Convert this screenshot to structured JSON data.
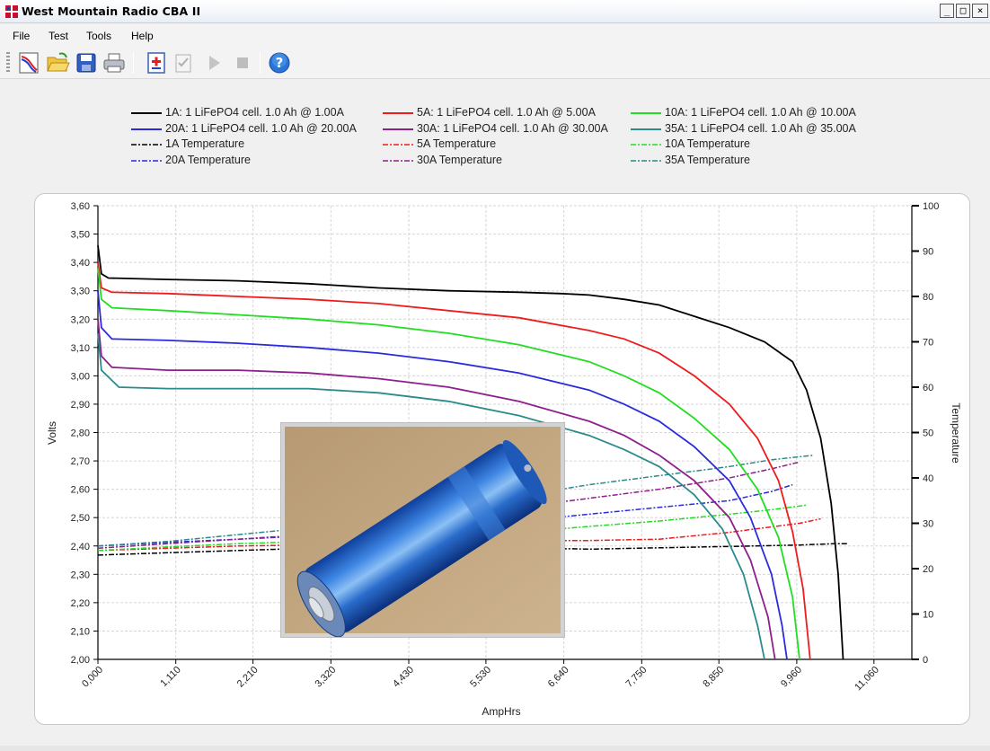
{
  "window": {
    "title": "West Mountain Radio CBA II",
    "controls": {
      "minimize": "_",
      "maximize": "□",
      "close": "×"
    }
  },
  "menu": [
    "File",
    "Test",
    "Tools",
    "Help"
  ],
  "toolbar": [
    "new-test-icon",
    "open-folder-icon",
    "save-icon",
    "print-icon",
    "add-test-icon",
    "checklist-icon",
    "play-icon",
    "stop-icon",
    "help-icon"
  ],
  "legend": [
    {
      "label": "1A: 1 LiFePO4 cell. 1.0 Ah @ 1.00A",
      "color": "#000000",
      "style": "solid"
    },
    {
      "label": "5A: 1 LiFePO4 cell. 1.0 Ah @ 5.00A",
      "color": "#ee1c1c",
      "style": "solid"
    },
    {
      "label": "10A: 1 LiFePO4 cell. 1.0 Ah @ 10.00A",
      "color": "#22dd22",
      "style": "solid"
    },
    {
      "label": "20A: 1 LiFePO4 cell. 1.0 Ah @ 20.00A",
      "color": "#2b2bdd",
      "style": "solid"
    },
    {
      "label": "30A: 1 LiFePO4 cell. 1.0 Ah @ 30.00A",
      "color": "#8e1f8e",
      "style": "solid"
    },
    {
      "label": "35A: 1 LiFePO4 cell. 1.0 Ah @ 35.00A",
      "color": "#2b8a8a",
      "style": "solid"
    },
    {
      "label": "1A Temperature",
      "color": "#000000",
      "style": "dashdot"
    },
    {
      "label": "5A Temperature",
      "color": "#ee1c1c",
      "style": "dashdot"
    },
    {
      "label": "10A Temperature",
      "color": "#22dd22",
      "style": "dashdot"
    },
    {
      "label": "20A Temperature",
      "color": "#2b2bdd",
      "style": "dashdot"
    },
    {
      "label": "30A Temperature",
      "color": "#8e1f8e",
      "style": "dashdot"
    },
    {
      "label": "35A Temperature",
      "color": "#2b8a8a",
      "style": "dashdot"
    }
  ],
  "chart_data": {
    "type": "line",
    "xlabel": "AmpHrs",
    "ylabel": "Volts",
    "y2label": "Temperature",
    "xlim": [
      0,
      11.6
    ],
    "ylim": [
      2.0,
      3.6
    ],
    "y2lim": [
      0,
      100
    ],
    "xticks": [
      "0,000",
      "1,110",
      "2,210",
      "3,320",
      "4,430",
      "5,530",
      "6,640",
      "7,750",
      "8,850",
      "9,960",
      "11,060"
    ],
    "xtick_values": [
      0,
      1.11,
      2.21,
      3.32,
      4.43,
      5.53,
      6.64,
      7.75,
      8.85,
      9.96,
      11.06
    ],
    "yticks": [
      "2,00",
      "2,10",
      "2,20",
      "2,30",
      "2,40",
      "2,50",
      "2,60",
      "2,70",
      "2,80",
      "2,90",
      "3,00",
      "3,10",
      "3,20",
      "3,30",
      "3,40",
      "3,50",
      "3,60"
    ],
    "ytick_values": [
      2.0,
      2.1,
      2.2,
      2.3,
      2.4,
      2.5,
      2.6,
      2.7,
      2.8,
      2.9,
      3.0,
      3.1,
      3.2,
      3.3,
      3.4,
      3.5,
      3.6
    ],
    "y2ticks": [
      "0",
      "10",
      "20",
      "30",
      "40",
      "50",
      "60",
      "70",
      "80",
      "90",
      "100"
    ],
    "y2tick_values": [
      0,
      10,
      20,
      30,
      40,
      50,
      60,
      70,
      80,
      90,
      100
    ],
    "grid": true,
    "voltage_series": [
      {
        "color": "#000000",
        "points": [
          [
            0,
            3.46
          ],
          [
            0.05,
            3.36
          ],
          [
            0.15,
            3.345
          ],
          [
            1,
            3.34
          ],
          [
            2,
            3.335
          ],
          [
            3,
            3.325
          ],
          [
            4,
            3.31
          ],
          [
            5,
            3.3
          ],
          [
            6,
            3.295
          ],
          [
            6.6,
            3.29
          ],
          [
            7,
            3.285
          ],
          [
            7.5,
            3.27
          ],
          [
            8,
            3.25
          ],
          [
            8.5,
            3.21
          ],
          [
            9,
            3.17
          ],
          [
            9.5,
            3.12
          ],
          [
            9.9,
            3.05
          ],
          [
            10.1,
            2.95
          ],
          [
            10.3,
            2.78
          ],
          [
            10.45,
            2.55
          ],
          [
            10.55,
            2.3
          ],
          [
            10.62,
            2.0
          ]
        ]
      },
      {
        "color": "#ee1c1c",
        "points": [
          [
            0,
            3.4
          ],
          [
            0.05,
            3.31
          ],
          [
            0.2,
            3.295
          ],
          [
            1,
            3.29
          ],
          [
            2,
            3.28
          ],
          [
            3,
            3.27
          ],
          [
            4,
            3.255
          ],
          [
            5,
            3.23
          ],
          [
            6,
            3.205
          ],
          [
            7,
            3.16
          ],
          [
            7.5,
            3.13
          ],
          [
            8,
            3.08
          ],
          [
            8.5,
            3.0
          ],
          [
            9,
            2.9
          ],
          [
            9.4,
            2.78
          ],
          [
            9.7,
            2.63
          ],
          [
            9.9,
            2.45
          ],
          [
            10.05,
            2.25
          ],
          [
            10.15,
            2.0
          ]
        ]
      },
      {
        "color": "#22dd22",
        "points": [
          [
            0,
            3.38
          ],
          [
            0.05,
            3.27
          ],
          [
            0.2,
            3.24
          ],
          [
            1,
            3.23
          ],
          [
            2,
            3.215
          ],
          [
            3,
            3.2
          ],
          [
            4,
            3.18
          ],
          [
            5,
            3.15
          ],
          [
            6,
            3.11
          ],
          [
            7,
            3.05
          ],
          [
            7.5,
            3.0
          ],
          [
            8,
            2.94
          ],
          [
            8.5,
            2.85
          ],
          [
            9,
            2.74
          ],
          [
            9.4,
            2.6
          ],
          [
            9.7,
            2.43
          ],
          [
            9.9,
            2.22
          ],
          [
            10.0,
            2.0
          ]
        ]
      },
      {
        "color": "#2b2bdd",
        "points": [
          [
            0,
            3.3
          ],
          [
            0.05,
            3.17
          ],
          [
            0.2,
            3.13
          ],
          [
            1,
            3.125
          ],
          [
            2,
            3.115
          ],
          [
            3,
            3.1
          ],
          [
            4,
            3.08
          ],
          [
            5,
            3.05
          ],
          [
            6,
            3.01
          ],
          [
            7,
            2.95
          ],
          [
            7.5,
            2.9
          ],
          [
            8,
            2.84
          ],
          [
            8.5,
            2.75
          ],
          [
            9,
            2.63
          ],
          [
            9.3,
            2.5
          ],
          [
            9.6,
            2.3
          ],
          [
            9.75,
            2.12
          ],
          [
            9.82,
            2.0
          ]
        ]
      },
      {
        "color": "#8e1f8e",
        "points": [
          [
            0,
            3.2
          ],
          [
            0.05,
            3.07
          ],
          [
            0.2,
            3.03
          ],
          [
            1,
            3.02
          ],
          [
            2,
            3.02
          ],
          [
            3,
            3.01
          ],
          [
            4,
            2.99
          ],
          [
            5,
            2.96
          ],
          [
            6,
            2.91
          ],
          [
            7,
            2.84
          ],
          [
            7.5,
            2.79
          ],
          [
            8,
            2.72
          ],
          [
            8.5,
            2.63
          ],
          [
            9,
            2.5
          ],
          [
            9.3,
            2.35
          ],
          [
            9.55,
            2.15
          ],
          [
            9.65,
            2.0
          ]
        ]
      },
      {
        "color": "#2b8a8a",
        "points": [
          [
            0,
            3.15
          ],
          [
            0.05,
            3.02
          ],
          [
            0.3,
            2.96
          ],
          [
            1,
            2.955
          ],
          [
            2,
            2.955
          ],
          [
            3,
            2.955
          ],
          [
            4,
            2.94
          ],
          [
            5,
            2.91
          ],
          [
            6,
            2.86
          ],
          [
            7,
            2.79
          ],
          [
            7.5,
            2.74
          ],
          [
            8,
            2.68
          ],
          [
            8.5,
            2.58
          ],
          [
            8.9,
            2.46
          ],
          [
            9.2,
            2.3
          ],
          [
            9.4,
            2.12
          ],
          [
            9.5,
            2.0
          ]
        ]
      }
    ],
    "temperature_series": [
      {
        "color": "#000000",
        "points": [
          [
            0,
            23
          ],
          [
            1,
            23.5
          ],
          [
            2,
            24
          ],
          [
            3,
            24.5
          ],
          [
            4,
            25
          ],
          [
            5,
            25
          ],
          [
            6,
            24.6
          ],
          [
            7,
            24.3
          ],
          [
            8,
            24.6
          ],
          [
            9,
            24.9
          ],
          [
            10,
            25.2
          ],
          [
            10.5,
            25.5
          ],
          [
            10.7,
            25.5
          ]
        ]
      },
      {
        "color": "#ee1c1c",
        "points": [
          [
            0,
            24
          ],
          [
            1,
            24.5
          ],
          [
            2,
            25
          ],
          [
            3,
            25.2
          ],
          [
            4,
            25.5
          ],
          [
            5,
            25.8
          ],
          [
            6,
            26.2
          ],
          [
            7,
            26.2
          ],
          [
            8,
            26.5
          ],
          [
            9,
            28
          ],
          [
            9.5,
            29
          ],
          [
            10,
            30
          ],
          [
            10.3,
            31
          ]
        ]
      },
      {
        "color": "#22dd22",
        "points": [
          [
            0,
            24
          ],
          [
            1,
            24.8
          ],
          [
            2,
            25.5
          ],
          [
            3,
            26
          ],
          [
            4,
            26.5
          ],
          [
            5,
            27.2
          ],
          [
            6,
            28
          ],
          [
            7,
            29.3
          ],
          [
            8,
            30.5
          ],
          [
            9,
            32
          ],
          [
            9.6,
            33
          ],
          [
            10.1,
            34
          ]
        ]
      },
      {
        "color": "#2b2bdd",
        "points": [
          [
            0,
            25
          ],
          [
            1,
            25.8
          ],
          [
            2,
            26.5
          ],
          [
            3,
            27.2
          ],
          [
            4,
            28
          ],
          [
            5,
            29.3
          ],
          [
            6,
            30.5
          ],
          [
            7,
            32
          ],
          [
            8,
            33.5
          ],
          [
            9,
            35
          ],
          [
            9.6,
            37
          ],
          [
            9.9,
            38.5
          ]
        ]
      },
      {
        "color": "#8e1f8e",
        "points": [
          [
            0,
            24.5
          ],
          [
            1,
            25.5
          ],
          [
            2,
            26.5
          ],
          [
            3,
            27.5
          ],
          [
            4,
            29
          ],
          [
            5,
            31
          ],
          [
            6,
            33.5
          ],
          [
            7,
            35.5
          ],
          [
            8,
            37.5
          ],
          [
            9,
            40
          ],
          [
            9.6,
            42
          ],
          [
            10,
            43.5
          ]
        ]
      },
      {
        "color": "#2b8a8a",
        "points": [
          [
            0,
            25
          ],
          [
            1,
            26
          ],
          [
            2,
            27.5
          ],
          [
            3,
            29
          ],
          [
            4,
            31
          ],
          [
            5,
            33.5
          ],
          [
            6,
            36
          ],
          [
            7,
            38.5
          ],
          [
            8,
            40.5
          ],
          [
            9,
            42.5
          ],
          [
            9.6,
            44
          ],
          [
            10.2,
            45
          ]
        ]
      }
    ]
  },
  "photo": {
    "subject": "blue-cylindrical-lifepo4-cell-photo"
  }
}
